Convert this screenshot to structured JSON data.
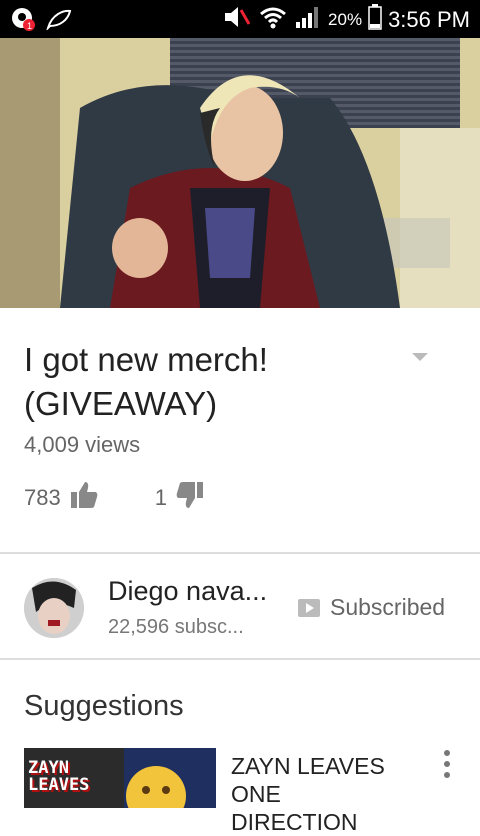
{
  "status_bar": {
    "battery": "20%",
    "time": "3:56 PM"
  },
  "video": {
    "title": "I got new merch! (GIVEAWAY)",
    "views": "4,009 views",
    "likes": "783",
    "dislikes": "1"
  },
  "channel": {
    "name": "Diego nava...",
    "subscribers": "22,596 subsc...",
    "subscribe_label": "Subscribed"
  },
  "suggestions": {
    "heading": "Suggestions",
    "items": [
      {
        "title": "ZAYN LEAVES ONE DIRECTION",
        "thumb_text": "ZAYN LEAVES"
      }
    ]
  },
  "colors": {
    "status_bar": "#000000",
    "divider": "#dddddd",
    "text_primary": "#222222",
    "text_secondary": "#666666"
  }
}
